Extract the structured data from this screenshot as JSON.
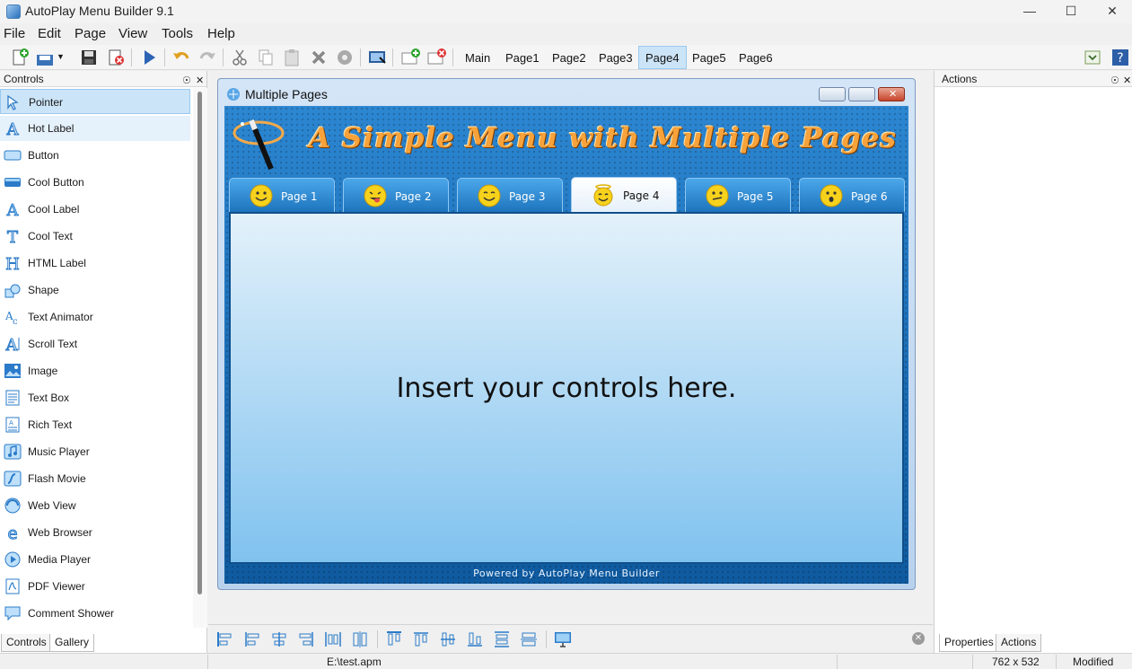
{
  "app": {
    "title": "AutoPlay Menu Builder 9.1"
  },
  "menu": {
    "items": [
      "File",
      "Edit",
      "Page",
      "View",
      "Tools",
      "Help"
    ]
  },
  "toolbar": {
    "pages": [
      "Main",
      "Page1",
      "Page2",
      "Page3",
      "Page4",
      "Page5",
      "Page6"
    ],
    "active_page": "Page4",
    "icons": [
      "new-file-icon",
      "save-dropdown-icon",
      "save-icon",
      "close-project-icon",
      "run-icon",
      "undo-icon",
      "redo-icon",
      "cut-icon",
      "copy-icon",
      "paste-icon",
      "delete-icon",
      "settings-icon",
      "preview-icon",
      "add-page-icon",
      "remove-page-icon"
    ]
  },
  "controls_panel": {
    "title": "Controls",
    "items": [
      "Pointer",
      "Hot Label",
      "Button",
      "Cool Button",
      "Cool Label",
      "Cool Text",
      "HTML Label",
      "Shape",
      "Text Animator",
      "Scroll Text",
      "Image",
      "Text Box",
      "Rich Text",
      "Music Player",
      "Flash Movie",
      "Web View",
      "Web Browser",
      "Media Player",
      "PDF Viewer",
      "Comment Shower"
    ],
    "tabs": [
      "Controls",
      "Gallery"
    ]
  },
  "actions_panel": {
    "title": "Actions",
    "tabs": [
      "Properties",
      "Actions"
    ]
  },
  "child_window": {
    "title": "Multiple Pages",
    "banner": "A Simple Menu with Multiple Pages",
    "tabs": [
      "Page 1",
      "Page 2",
      "Page 3",
      "Page 4",
      "Page 5",
      "Page 6"
    ],
    "active_tab": "Page 4",
    "content_text": "Insert your controls here.",
    "footer": "Powered by AutoPlay Menu Builder"
  },
  "status": {
    "path": "E:\\test.apm",
    "size": "762 x 532",
    "state": "Modified"
  },
  "colors": {
    "accent": "#cce4f7",
    "menu_blue": "#1a6cb4",
    "banner_orange": "#f7a23a"
  }
}
